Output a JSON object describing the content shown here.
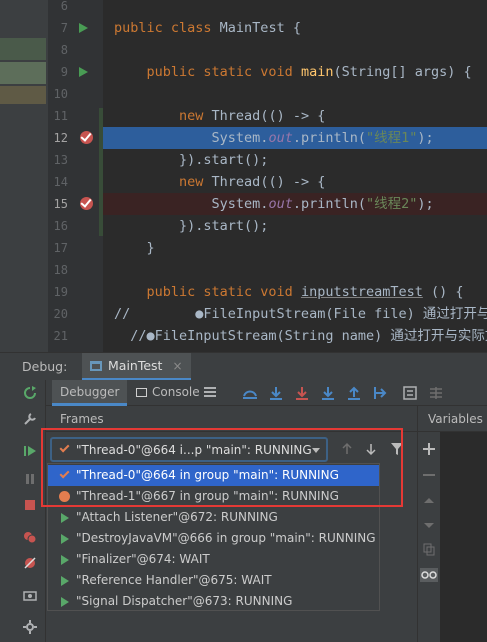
{
  "editor": {
    "lines": [
      {
        "num": "6",
        "segments": [
          {
            "t": "",
            "c": ""
          }
        ]
      },
      {
        "num": "7",
        "segments": [
          {
            "t": "public class ",
            "c": "kw"
          },
          {
            "t": "MainTest {",
            "c": ""
          }
        ]
      },
      {
        "num": "8",
        "segments": [
          {
            "t": "",
            "c": ""
          }
        ]
      },
      {
        "num": "9",
        "segments": [
          {
            "t": "    public static void ",
            "c": "kw"
          },
          {
            "t": "main",
            "c": "fn"
          },
          {
            "t": "(String[] args) {",
            "c": ""
          }
        ]
      },
      {
        "num": "10",
        "segments": [
          {
            "t": "",
            "c": ""
          }
        ]
      },
      {
        "num": "11",
        "segments": [
          {
            "t": "        new ",
            "c": "kw"
          },
          {
            "t": "Thread(() -> {",
            "c": ""
          }
        ]
      },
      {
        "num": "12",
        "segments": [
          {
            "t": "            System.",
            "c": ""
          },
          {
            "t": "out",
            "c": "fld"
          },
          {
            "t": ".println(",
            "c": ""
          },
          {
            "t": "\"线程1\"",
            "c": "str"
          },
          {
            "t": ");",
            "c": ""
          }
        ]
      },
      {
        "num": "13",
        "segments": [
          {
            "t": "        }).start();",
            "c": ""
          }
        ]
      },
      {
        "num": "14",
        "segments": [
          {
            "t": "        new ",
            "c": "kw"
          },
          {
            "t": "Thread(() -> {",
            "c": ""
          }
        ]
      },
      {
        "num": "15",
        "segments": [
          {
            "t": "            System.",
            "c": ""
          },
          {
            "t": "out",
            "c": "fld"
          },
          {
            "t": ".println(",
            "c": ""
          },
          {
            "t": "\"线程2\"",
            "c": "str"
          },
          {
            "t": ");",
            "c": ""
          }
        ]
      },
      {
        "num": "16",
        "segments": [
          {
            "t": "        }).start();",
            "c": ""
          }
        ]
      },
      {
        "num": "17",
        "segments": [
          {
            "t": "    }",
            "c": ""
          }
        ]
      },
      {
        "num": "18",
        "segments": [
          {
            "t": "",
            "c": ""
          }
        ]
      },
      {
        "num": "19",
        "segments": [
          {
            "t": "    public static void ",
            "c": "kw"
          },
          {
            "t": "inputstreamTest",
            "c": "und"
          },
          {
            "t": " () {",
            "c": ""
          }
        ]
      },
      {
        "num": "20",
        "segments": [
          {
            "t": "//        ●FileInputStream(File file) 通过打开与实",
            "c": "cm"
          }
        ]
      },
      {
        "num": "21",
        "segments": [
          {
            "t": "  //●FileInputStream(String name) 通过打开与实际文件",
            "c": "cm"
          }
        ]
      }
    ]
  },
  "debug": {
    "label": "Debug:",
    "tab_title": "MainTest",
    "tab_close": "×",
    "tabs": {
      "debugger": "Debugger",
      "console": "Console"
    },
    "frames_label": "Frames",
    "variables_label": "Variables",
    "combo_value": "\"Thread-0\"@664 i...p \"main\": RUNNING",
    "threads": [
      {
        "label": "\"Thread-0\"@664 in group \"main\": RUNNING",
        "icon": "check-icon",
        "selected": true
      },
      {
        "label": "\"Thread-1\"@667 in group \"main\": RUNNING",
        "icon": "breakpoint-dot-icon",
        "selected": false
      },
      {
        "label": "\"Attach Listener\"@672: RUNNING",
        "icon": "thread-run-icon",
        "selected": false
      },
      {
        "label": "\"DestroyJavaVM\"@666 in group \"main\": RUNNING",
        "icon": "thread-run-icon",
        "selected": false
      },
      {
        "label": "\"Finalizer\"@674: WAIT",
        "icon": "thread-run-icon",
        "selected": false
      },
      {
        "label": "\"Reference Handler\"@675: WAIT",
        "icon": "thread-run-icon",
        "selected": false
      },
      {
        "label": "\"Signal Dispatcher\"@673: RUNNING",
        "icon": "thread-run-icon",
        "selected": false
      }
    ],
    "colors": {
      "accent": "#4a88c7",
      "selection": "#2f65ca",
      "annotation": "#e53935",
      "thread_icon": "#e37d4f",
      "run_green": "#59a869"
    }
  }
}
